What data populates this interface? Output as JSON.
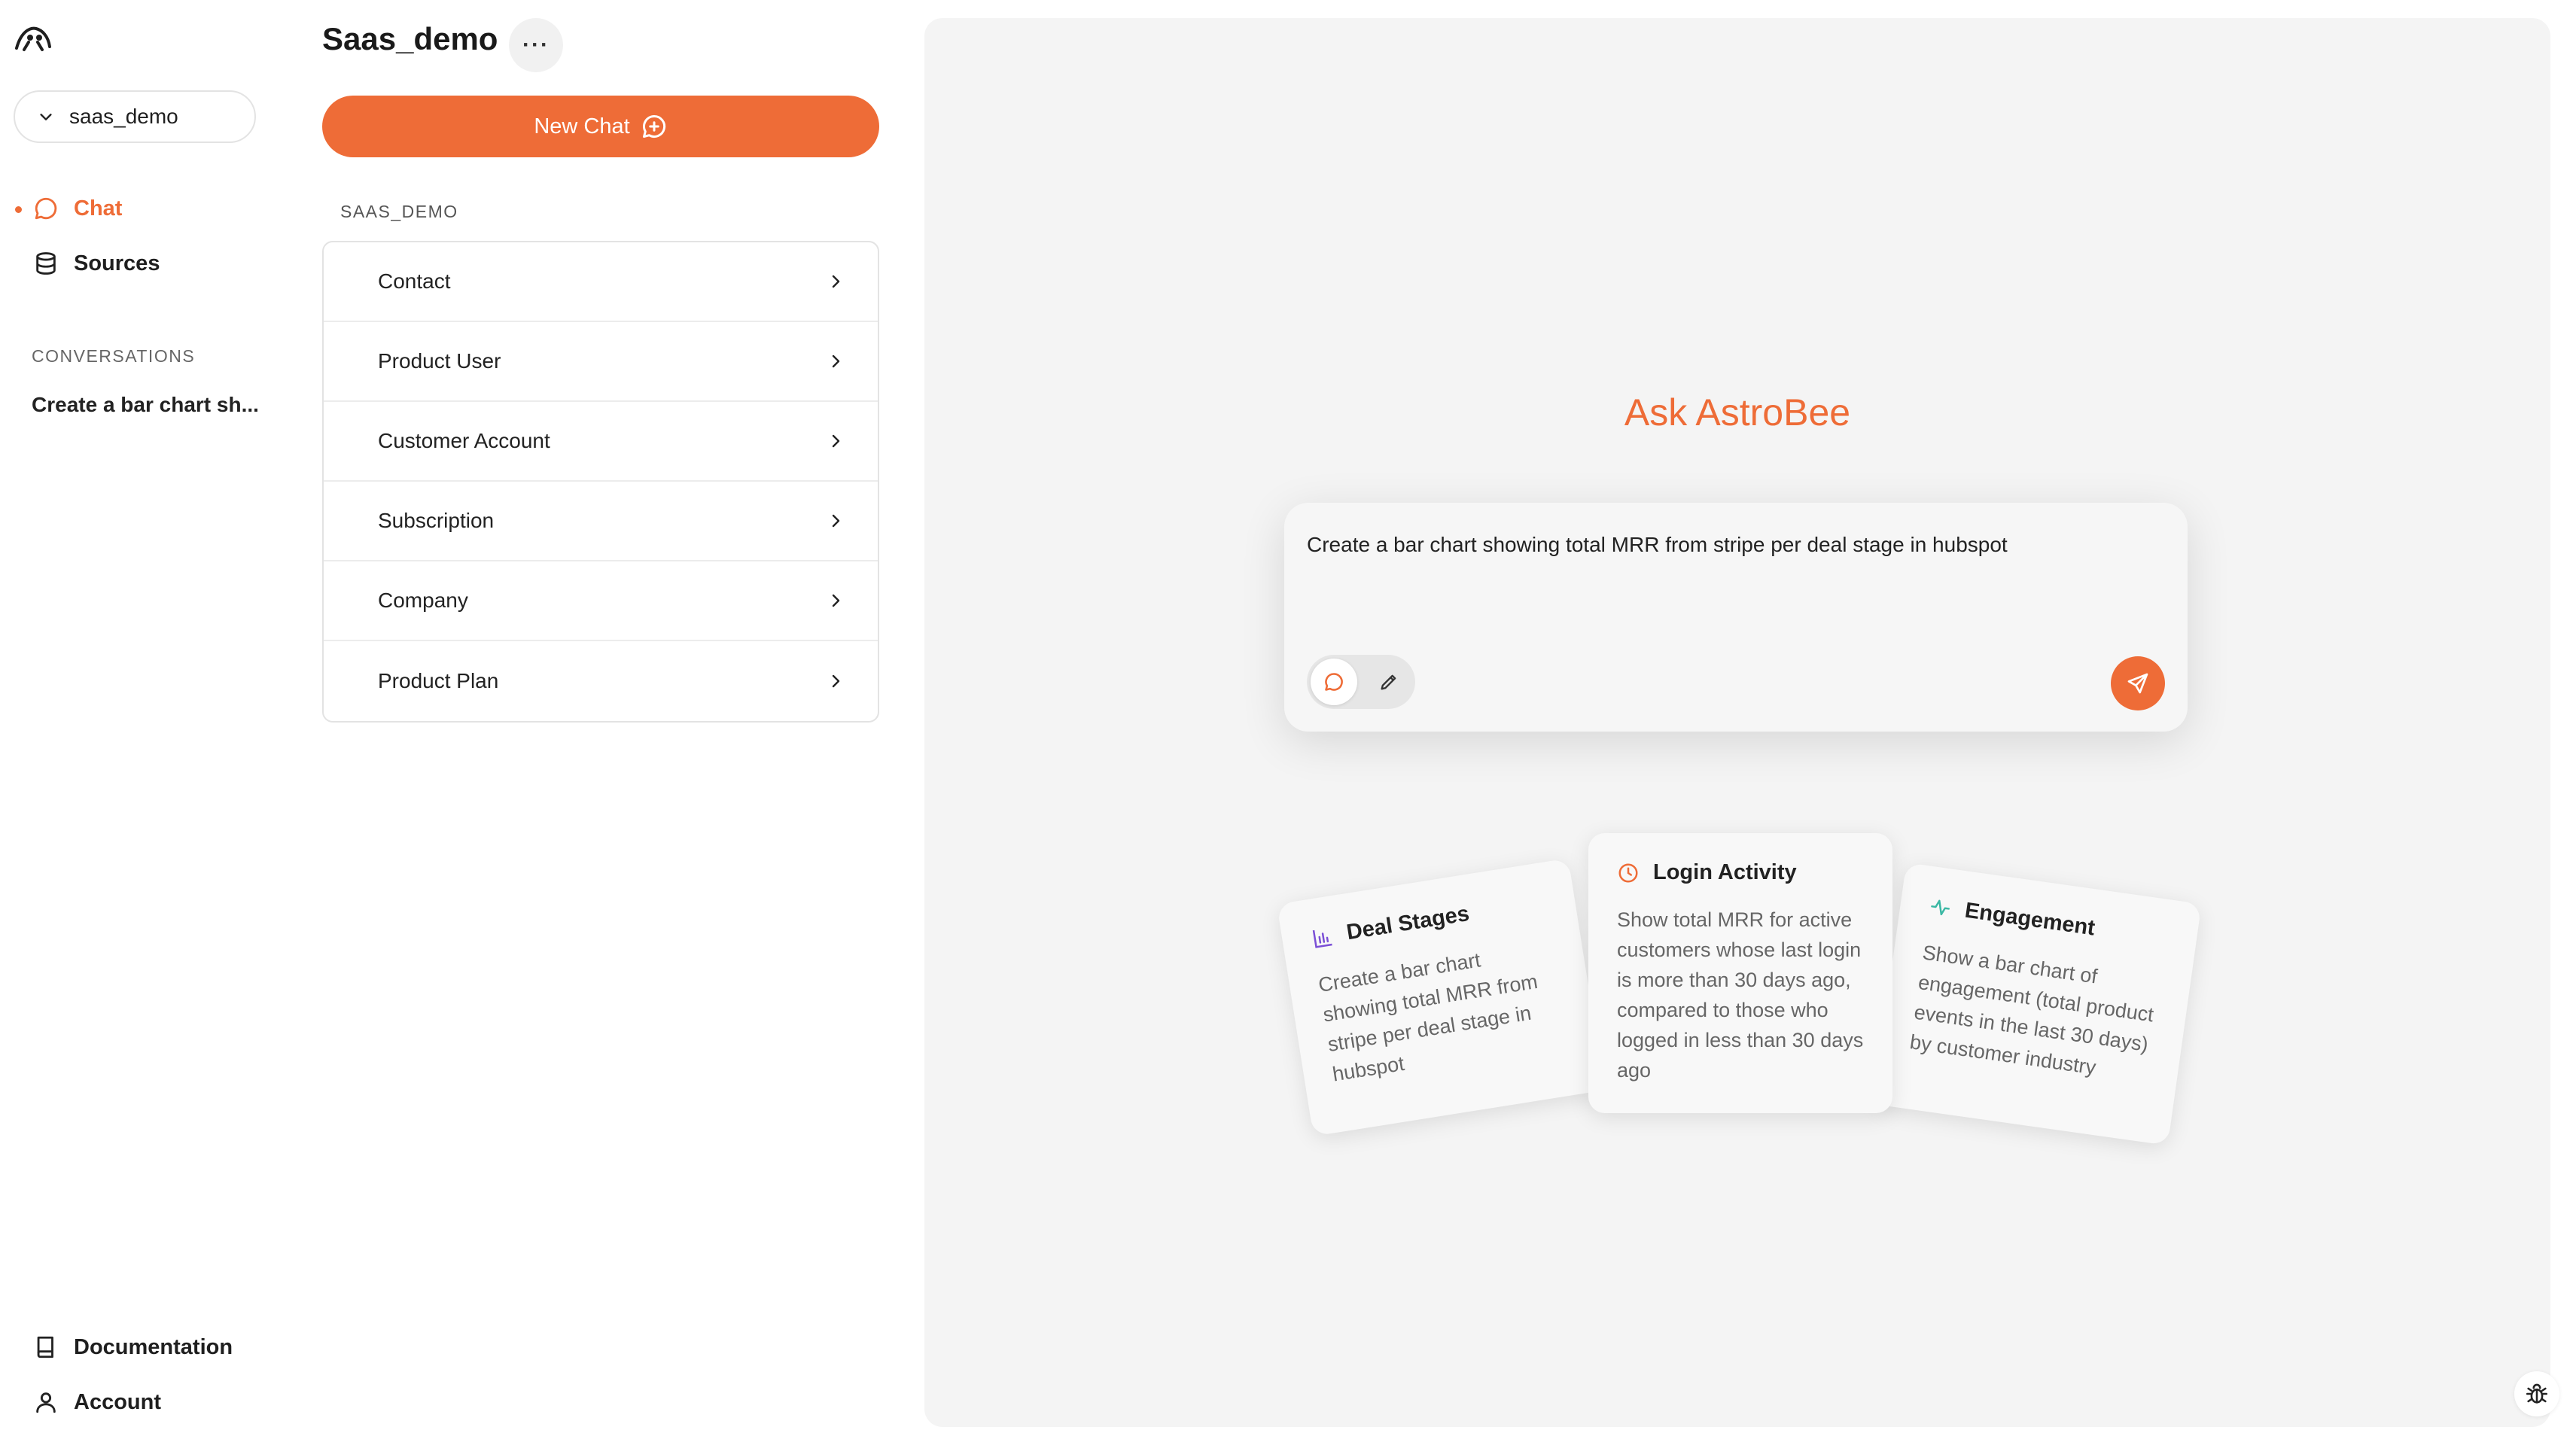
{
  "sidebar": {
    "db_selector": "saas_demo",
    "nav": {
      "chat": "Chat",
      "sources": "Sources"
    },
    "conversations_label": "CONVERSATIONS",
    "conversations": [
      "Create a bar chart sh..."
    ],
    "footer": {
      "documentation": "Documentation",
      "account": "Account"
    }
  },
  "panel": {
    "title": "Saas_demo",
    "more_label": "···",
    "new_chat_label": "New Chat",
    "section_label": "SAAS_DEMO",
    "tables": [
      "Contact",
      "Product User",
      "Customer Account",
      "Subscription",
      "Company",
      "Product Plan"
    ]
  },
  "main": {
    "heading": "Ask AstroBee",
    "composer": {
      "value": "Create a bar chart showing total MRR from stripe per deal stage in hubspot"
    },
    "suggestions": [
      {
        "title": "Deal Stages",
        "icon": "bar-chart-icon",
        "text": "Create a bar chart showing total MRR from stripe per deal stage in hubspot"
      },
      {
        "title": "Login Activity",
        "icon": "clock-icon",
        "text": "Show total MRR for active customers whose last login is more than 30 days ago, compared to those who logged in less than 30 days ago"
      },
      {
        "title": "Engagement",
        "icon": "activity-icon",
        "text": "Show a bar chart of engagement (total product events in the last 30 days) by customer industry"
      }
    ]
  },
  "colors": {
    "accent": "#ee6c37",
    "main_bg": "#f4f4f4",
    "deal_icon": "#7b4fd6",
    "engagement_icon": "#3bb8a4"
  }
}
